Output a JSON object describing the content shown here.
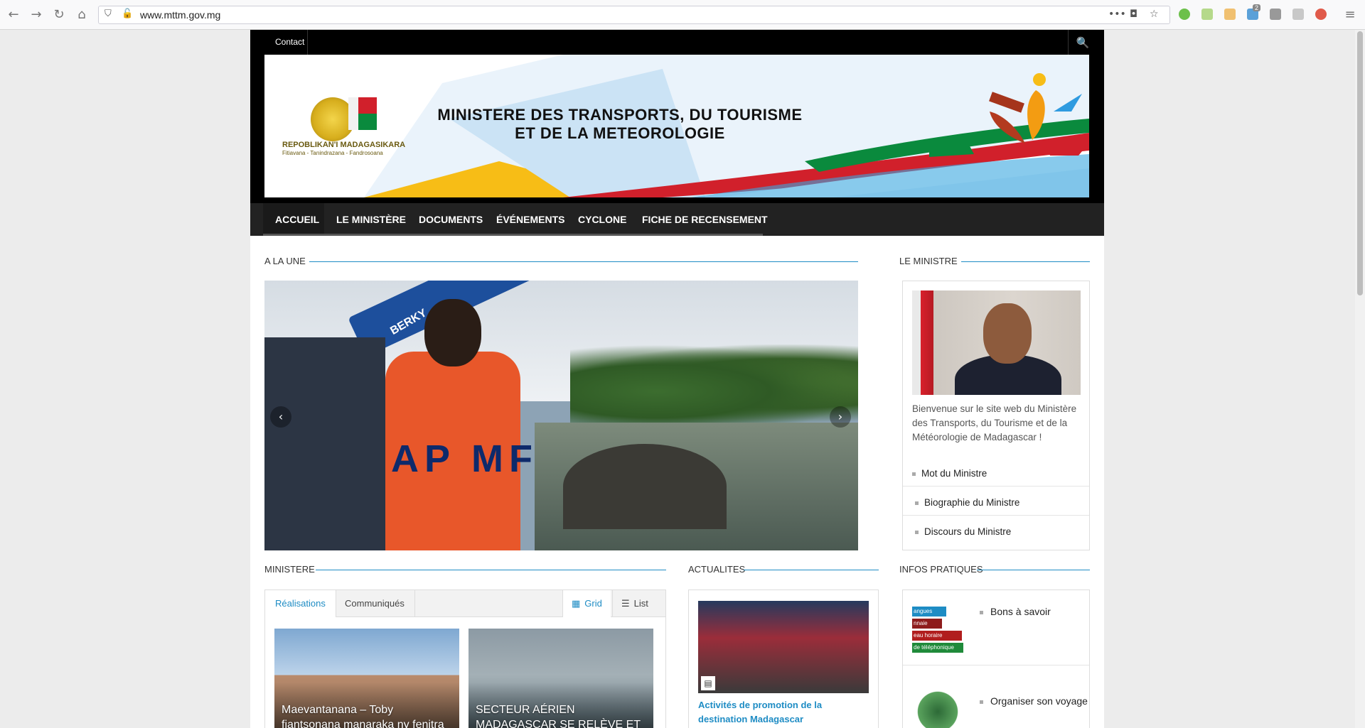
{
  "browser": {
    "url": "www.mttm.gov.mg",
    "menu_dots": "•••",
    "badge_count": "2"
  },
  "topbar": {
    "contact_label": "Contact"
  },
  "banner": {
    "title_line1": "MINISTERE DES TRANSPORTS, DU TOURISME",
    "title_line2": "ET DE LA METEOROLOGIE",
    "republic": "REPOBLIKAN'I MADAGASIKARA",
    "motto": "Fitiavana - Tanindrazana - Fandrosoana"
  },
  "nav": {
    "items": [
      {
        "label": "ACCUEIL"
      },
      {
        "label": "LE MINISTÈRE"
      },
      {
        "label": "DOCUMENTS"
      },
      {
        "label": "ÉVÉNEMENTS"
      },
      {
        "label": "CYCLONE"
      },
      {
        "label": "FICHE DE RECENSEMENT"
      }
    ]
  },
  "sections": {
    "a_la_une": "A LA UNE",
    "le_ministre": "LE MINISTRE",
    "ministere": "MINISTERE",
    "actualites": "ACTUALITES",
    "infos_pratiques": "INFOS PRATIQUES"
  },
  "slider": {
    "vest_text": "AP MF",
    "boom_text": "BERKY"
  },
  "minister": {
    "welcome": "Bienvenue sur le site web du Ministère des Transports, du Tourisme et de la Météorologie de Madagascar !",
    "links": [
      {
        "label": "Mot du Ministre"
      },
      {
        "label": "Biographie du Ministre"
      },
      {
        "label": "Discours du Ministre"
      }
    ]
  },
  "ministere_tabs": {
    "tabs": [
      {
        "label": "Réalisations"
      },
      {
        "label": "Communiqués"
      }
    ],
    "views": [
      {
        "label": "Grid"
      },
      {
        "label": "List"
      }
    ],
    "cards": [
      {
        "caption": "Maevantanana – Toby fiantsonana manaraka ny fenitra"
      },
      {
        "caption": "SECTEUR AÉRIEN MADAGASCAR SE RELÈVE ET"
      }
    ]
  },
  "actualites": {
    "title": "Activités de promotion de la destination Madagascar"
  },
  "infos": {
    "items": [
      {
        "label": "Bons à savoir"
      },
      {
        "label": "Organiser son voyage"
      }
    ],
    "ribbons": [
      "angues",
      "nnaie",
      "eau horaire",
      "de téléphonique"
    ]
  },
  "colors": {
    "accent": "#1e8cc4",
    "navbar": "#222222",
    "topbar": "#000000"
  }
}
